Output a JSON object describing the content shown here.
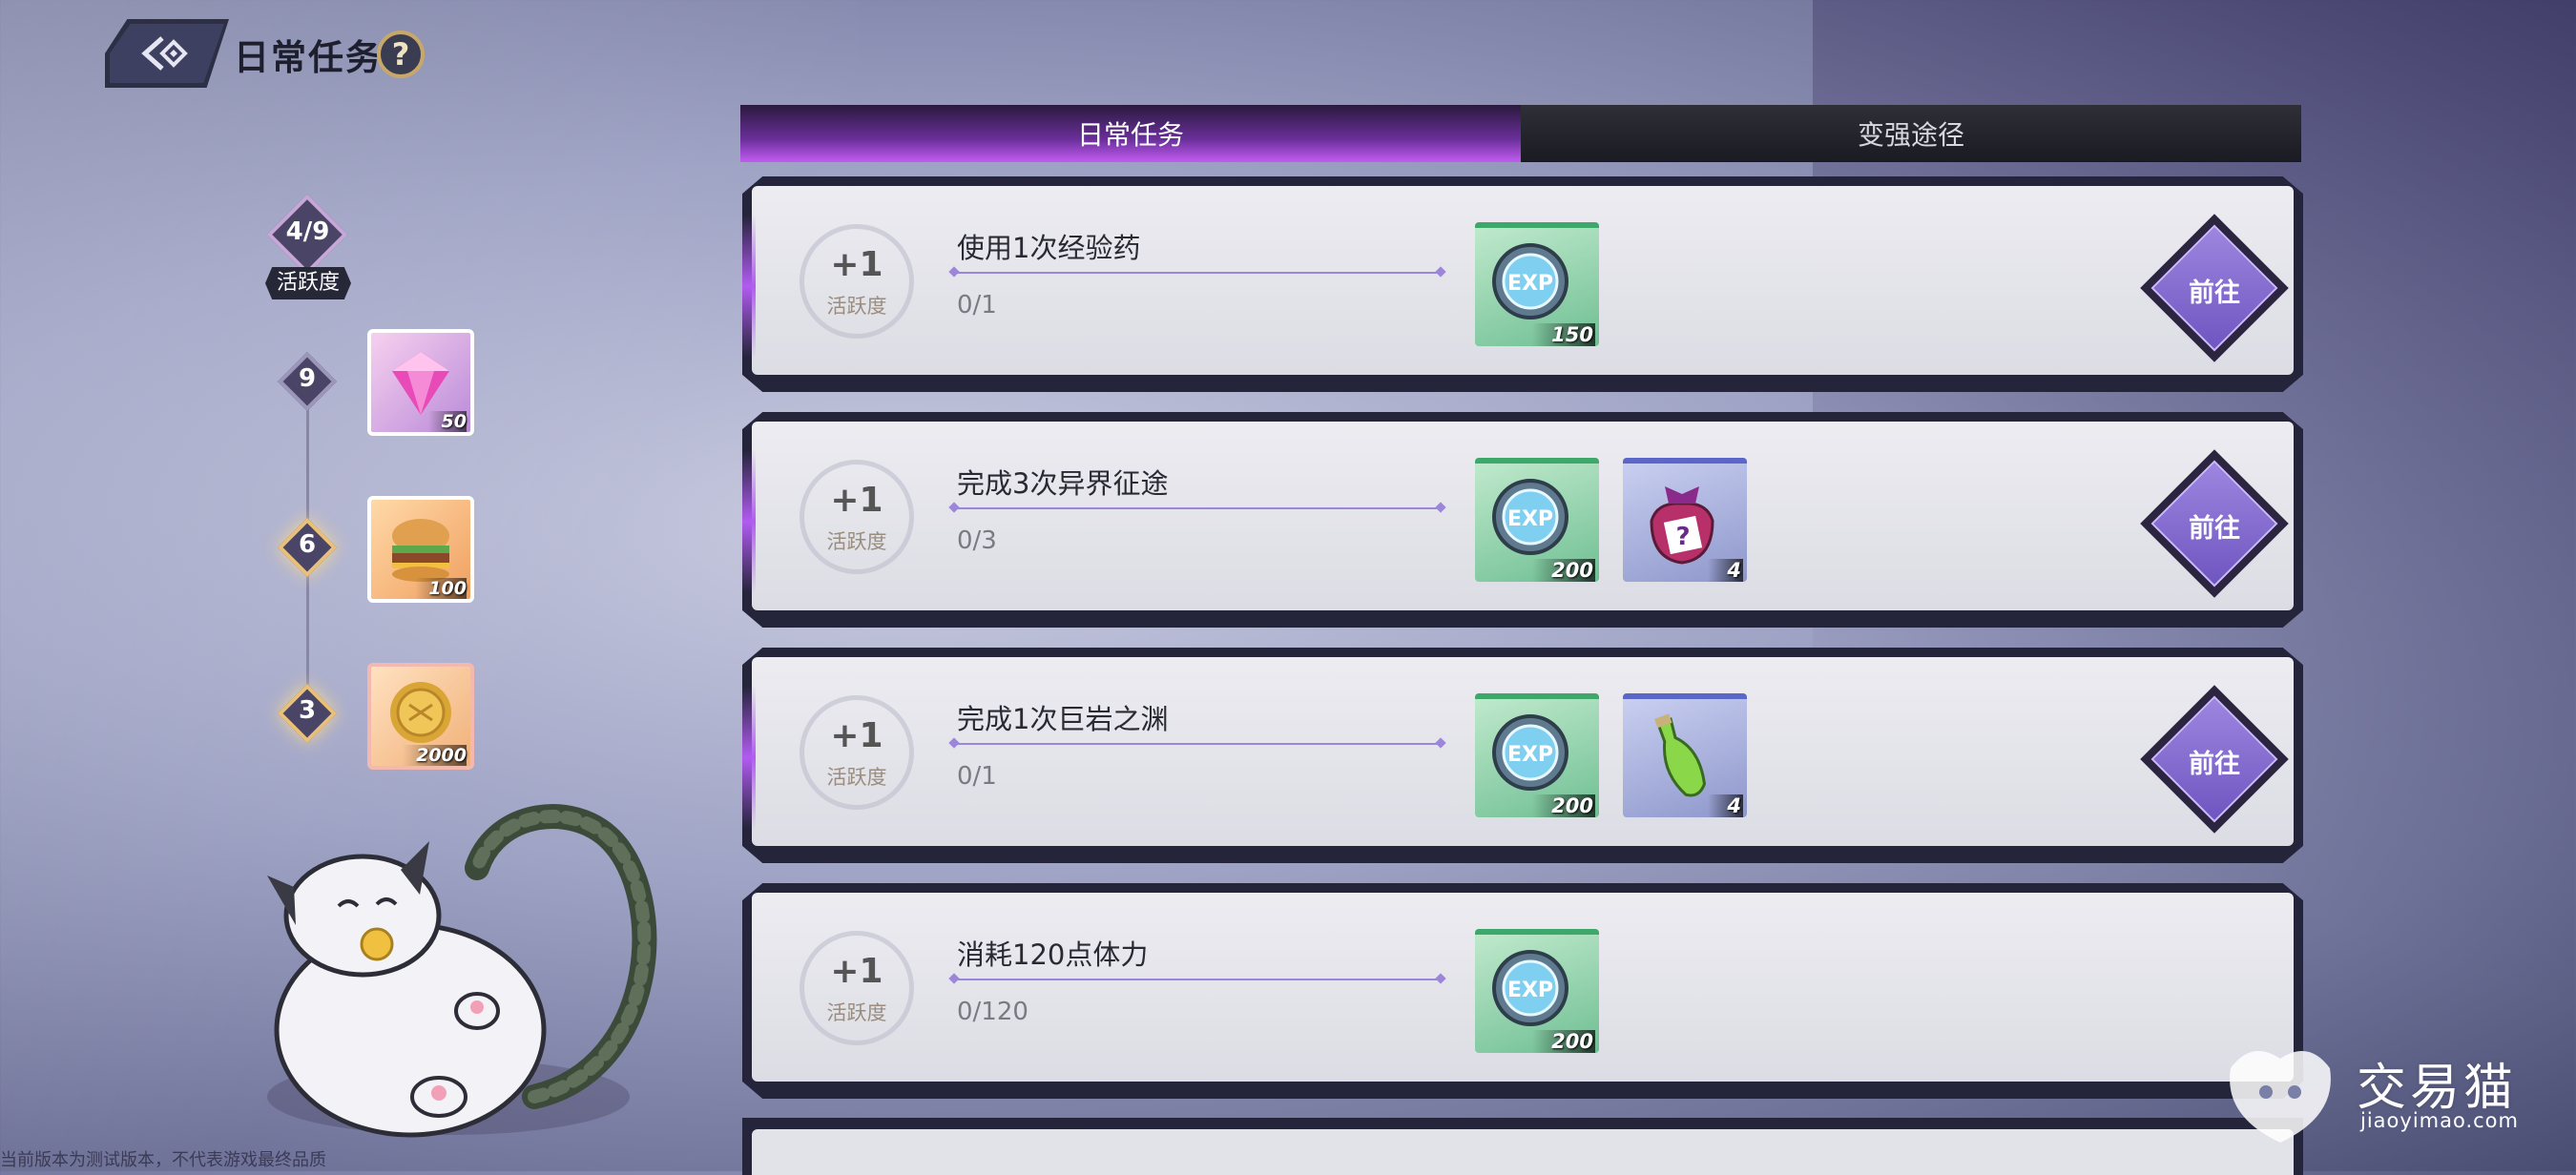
{
  "header": {
    "title": "日常任务",
    "help": "?"
  },
  "activity": {
    "current": "4/9",
    "label": "活跃度",
    "milestones": [
      {
        "value": "9",
        "reward_icon": "gem-icon",
        "count": "50"
      },
      {
        "value": "6",
        "reward_icon": "burger-icon",
        "count": "100"
      },
      {
        "value": "3",
        "reward_icon": "gold-coin-icon",
        "count": "2000"
      }
    ]
  },
  "tabs": [
    {
      "label": "日常任务",
      "active": true
    },
    {
      "label": "变强途径",
      "active": false
    }
  ],
  "tasks": [
    {
      "points": "+1",
      "points_label": "活跃度",
      "name": "使用1次经验药",
      "progress": "0/1",
      "rewards": [
        {
          "icon": "exp-coin-icon",
          "count": "150",
          "rarity": "green"
        }
      ],
      "button": "前往"
    },
    {
      "points": "+1",
      "points_label": "活跃度",
      "name": "完成3次异界征途",
      "progress": "0/3",
      "rewards": [
        {
          "icon": "exp-coin-icon",
          "count": "200",
          "rarity": "green"
        },
        {
          "icon": "mystery-bag-icon",
          "count": "4",
          "rarity": "purple"
        }
      ],
      "button": "前往"
    },
    {
      "points": "+1",
      "points_label": "活跃度",
      "name": "完成1次巨岩之渊",
      "progress": "0/1",
      "rewards": [
        {
          "icon": "exp-coin-icon",
          "count": "200",
          "rarity": "green"
        },
        {
          "icon": "potion-bottle-icon",
          "count": "4",
          "rarity": "purple"
        }
      ],
      "button": "前往"
    },
    {
      "points": "+1",
      "points_label": "活跃度",
      "name": "消耗120点体力",
      "progress": "0/120",
      "rewards": [
        {
          "icon": "exp-coin-icon",
          "count": "200",
          "rarity": "green"
        }
      ],
      "button": ""
    }
  ],
  "footer": {
    "disclaimer": "当前版本为测试版本，不代表游戏最终品质"
  },
  "watermark": {
    "name": "交易猫",
    "url": "jiaoyimao.com"
  },
  "colors": {
    "tab_active": "#8a3fd0",
    "go_button": "#7e66d0",
    "reward_green": "#3da86a",
    "reward_purple": "#5a66c8"
  }
}
